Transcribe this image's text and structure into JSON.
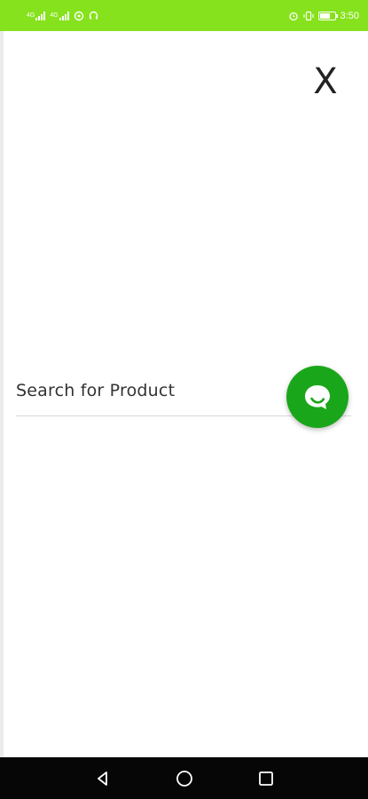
{
  "status_bar": {
    "sim1_tag": "4G",
    "sim2_tag": "4G",
    "time": "3:50",
    "background": "#86e21c",
    "icons": [
      "signal-icon",
      "signal-icon",
      "wifi-hotspot-icon",
      "headset-icon",
      "alarm-icon",
      "vibrate-icon",
      "battery-icon"
    ]
  },
  "header": {
    "close_label": "X"
  },
  "search": {
    "label": "Search for Product"
  },
  "chat_fab": {
    "icon": "chat-bubble-icon",
    "color": "#1aa61a"
  },
  "nav_bar": {
    "items": [
      "back-icon",
      "home-icon",
      "recents-icon"
    ]
  }
}
